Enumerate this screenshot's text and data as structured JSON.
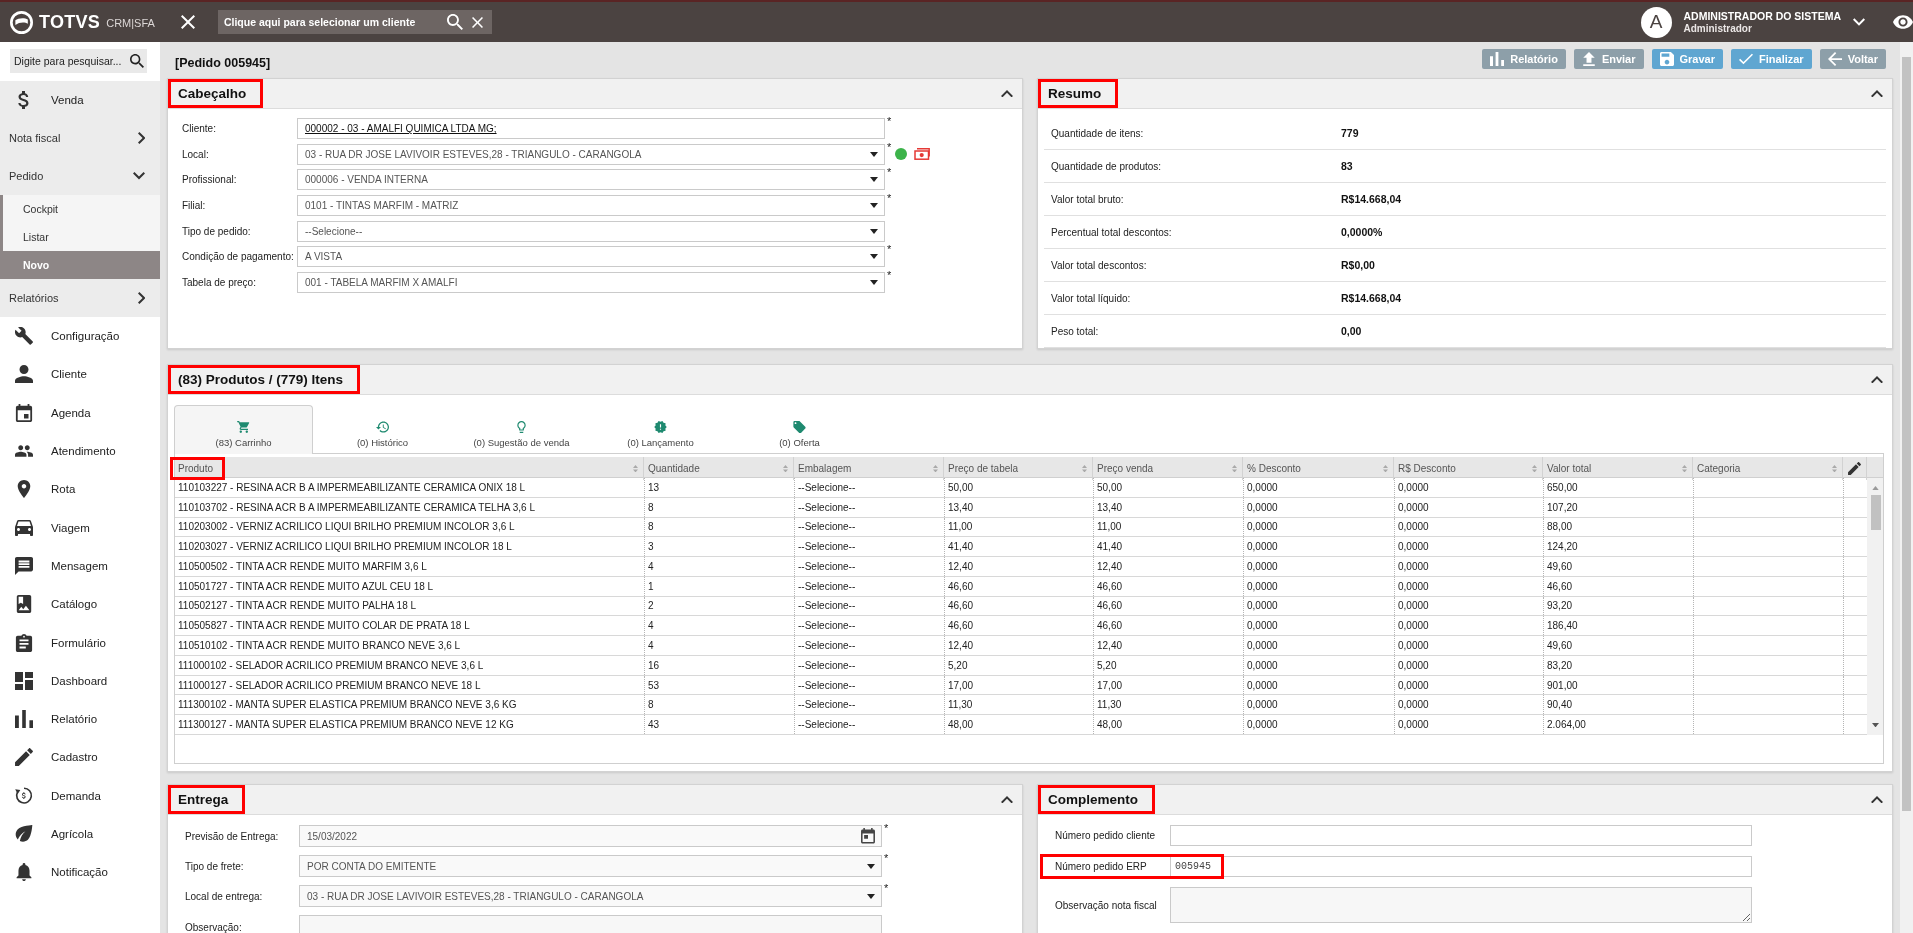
{
  "topbar": {
    "brand": "TOTVS",
    "product": "CRM|SFA",
    "client_search": {
      "placeholder": "Clique aqui para selecionar um cliente"
    },
    "user": {
      "initial": "A",
      "name": "ADMINISTRADOR DO SISTEMA",
      "role": "Administrador"
    }
  },
  "sidebar": {
    "search": {
      "placeholder": "Digite para pesquisar..."
    },
    "items": [
      {
        "label": "Venda",
        "selected": true,
        "children": [
          {
            "label": "Nota fiscal",
            "expanded": false
          },
          {
            "label": "Pedido",
            "expanded": true,
            "children": [
              {
                "label": "Cockpit",
                "selected": false
              },
              {
                "label": "Listar",
                "selected": false
              },
              {
                "label": "Novo",
                "selected": true
              }
            ]
          },
          {
            "label": "Relatórios",
            "expanded": false
          }
        ]
      },
      {
        "label": "Configuração",
        "selected": false
      },
      {
        "label": "Cliente",
        "selected": false
      },
      {
        "label": "Agenda",
        "selected": false
      },
      {
        "label": "Atendimento",
        "selected": false
      },
      {
        "label": "Rota",
        "selected": false
      },
      {
        "label": "Viagem",
        "selected": false
      },
      {
        "label": "Mensagem",
        "selected": false
      },
      {
        "label": "Catálogo",
        "selected": false
      },
      {
        "label": "Formulário",
        "selected": false
      },
      {
        "label": "Dashboard",
        "selected": false
      },
      {
        "label": "Relatório",
        "selected": false
      },
      {
        "label": "Cadastro",
        "selected": false
      },
      {
        "label": "Demanda",
        "selected": false
      },
      {
        "label": "Agrícola",
        "selected": false
      },
      {
        "label": "Notificação",
        "selected": false
      }
    ]
  },
  "page": {
    "title": "[Pedido 005945]",
    "actions": [
      {
        "label": "Relatório",
        "disabled": false
      },
      {
        "label": "Enviar",
        "disabled": false
      },
      {
        "label": "Gravar",
        "disabled": true
      },
      {
        "label": "Finalizar",
        "disabled": true
      },
      {
        "label": "Voltar",
        "disabled": false
      }
    ]
  },
  "cabecalho": {
    "title": "Cabeçalho",
    "highlighted": true,
    "expanded": true,
    "fields": [
      {
        "label": "Cliente:",
        "kind": "link",
        "value": "000002 - 03 - AMALFI QUIMICA LTDA MG;",
        "required_mark": "*"
      },
      {
        "label": "Local:",
        "kind": "select",
        "value": "03 - RUA DR JOSE LAVIVOIR ESTEVES,28 - TRIANGULO - CARANGOLA",
        "required_mark": "*",
        "color": "#3cb34a"
      },
      {
        "label": "Profissional:",
        "kind": "select",
        "value": "000006 - VENDA INTERNA",
        "required_mark": "*"
      },
      {
        "label": "Filial:",
        "kind": "select",
        "value": "0101 - TINTAS MARFIM - MATRIZ",
        "required_mark": "*"
      },
      {
        "label": "Tipo de pedido:",
        "kind": "select",
        "value": "--Selecione--"
      },
      {
        "label": "Condição de pagamento:",
        "kind": "select",
        "value": "A VISTA",
        "required_mark": "*"
      },
      {
        "label": "Tabela de preço:",
        "kind": "select",
        "value": "001 - TABELA MARFIM X AMALFI",
        "required_mark": "*"
      }
    ]
  },
  "resumo": {
    "title": "Resumo",
    "highlighted": true,
    "expanded": true,
    "rows": [
      {
        "label": "Quantidade de itens:",
        "value": "779"
      },
      {
        "label": "Quantidade de produtos:",
        "value": "83"
      },
      {
        "label": "Valor total bruto:",
        "value": "R$14.668,04"
      },
      {
        "label": "Percentual total descontos:",
        "value": "0,0000%"
      },
      {
        "label": "Valor total descontos:",
        "value": "R$0,00"
      },
      {
        "label": "Valor total líquido:",
        "value": "R$14.668,04"
      },
      {
        "label": "Peso total:",
        "value": "0,00"
      }
    ]
  },
  "produtos": {
    "title": "(83) Produtos / (779) Itens",
    "highlighted": true,
    "expanded": true,
    "tabs": [
      {
        "label": "(83) Carrinho",
        "selected": true
      },
      {
        "label": "(0) Histórico",
        "selected": false
      },
      {
        "label": "(0) Sugestão de venda",
        "selected": false
      },
      {
        "label": "(0) Lançamento",
        "selected": false
      },
      {
        "label": "(0) Oferta",
        "selected": false
      }
    ],
    "table": {
      "columns": [
        {
          "label": "Produto",
          "highlighted": true
        },
        {
          "label": "Quantidade",
          "highlighted": false
        },
        {
          "label": "Embalagem",
          "highlighted": false
        },
        {
          "label": "Preço de tabela",
          "highlighted": false
        },
        {
          "label": "Preço venda",
          "highlighted": false
        },
        {
          "label": "% Desconto",
          "highlighted": false
        },
        {
          "label": "R$ Desconto",
          "highlighted": false
        },
        {
          "label": "Valor total",
          "highlighted": false
        },
        {
          "label": "Categoria",
          "highlighted": false
        }
      ],
      "rows": [
        [
          "110103227 - RESINA ACR B A IMPERMEABILIZANTE CERAMICA ONIX 18 L",
          "13",
          "--Selecione--",
          "50,00",
          "50,00",
          "0,0000",
          "0,0000",
          "650,00"
        ],
        [
          "110103702 - RESINA ACR B A IMPERMEABILIZANTE CERAMICA TELHA 3,6 L",
          "8",
          "--Selecione--",
          "13,40",
          "13,40",
          "0,0000",
          "0,0000",
          "107,20"
        ],
        [
          "110203002 - VERNIZ ACRILICO LIQUI BRILHO PREMIUM INCOLOR 3,6 L",
          "8",
          "--Selecione--",
          "11,00",
          "11,00",
          "0,0000",
          "0,0000",
          "88,00"
        ],
        [
          "110203027 - VERNIZ ACRILICO LIQUI BRILHO PREMIUM INCOLOR 18 L",
          "3",
          "--Selecione--",
          "41,40",
          "41,40",
          "0,0000",
          "0,0000",
          "124,20"
        ],
        [
          "110500502 - TINTA ACR RENDE MUITO MARFIM 3,6 L",
          "4",
          "--Selecione--",
          "12,40",
          "12,40",
          "0,0000",
          "0,0000",
          "49,60"
        ],
        [
          "110501727 - TINTA ACR RENDE MUITO AZUL CEU 18 L",
          "1",
          "--Selecione--",
          "46,60",
          "46,60",
          "0,0000",
          "0,0000",
          "46,60"
        ],
        [
          "110502127 - TINTA ACR RENDE MUITO PALHA 18 L",
          "2",
          "--Selecione--",
          "46,60",
          "46,60",
          "0,0000",
          "0,0000",
          "93,20"
        ],
        [
          "110505827 - TINTA ACR RENDE MUITO COLAR DE PRATA 18 L",
          "4",
          "--Selecione--",
          "46,60",
          "46,60",
          "0,0000",
          "0,0000",
          "186,40"
        ],
        [
          "110510102 - TINTA ACR RENDE MUITO BRANCO NEVE 3,6 L",
          "4",
          "--Selecione--",
          "12,40",
          "12,40",
          "0,0000",
          "0,0000",
          "49,60"
        ],
        [
          "111000102 - SELADOR ACRILICO PREMIUM BRANCO NEVE 3,6 L",
          "16",
          "--Selecione--",
          "5,20",
          "5,20",
          "0,0000",
          "0,0000",
          "83,20"
        ],
        [
          "111000127 - SELADOR ACRILICO PREMIUM BRANCO NEVE 18 L",
          "53",
          "--Selecione--",
          "17,00",
          "17,00",
          "0,0000",
          "0,0000",
          "901,00"
        ],
        [
          "111300102 - MANTA SUPER ELASTICA PREMIUM BRANCO NEVE 3,6 KG",
          "8",
          "--Selecione--",
          "11,30",
          "11,30",
          "0,0000",
          "0,0000",
          "90,40"
        ],
        [
          "111300127 - MANTA SUPER ELASTICA PREMIUM BRANCO NEVE 12 KG",
          "43",
          "--Selecione--",
          "48,00",
          "48,00",
          "0,0000",
          "0,0000",
          "2.064,00"
        ]
      ]
    }
  },
  "entrega": {
    "title": "Entrega",
    "highlighted": true,
    "expanded": true,
    "fields": [
      {
        "label": "Previsão de Entrega:",
        "kind": "date",
        "value": "15/03/2022",
        "required_mark": "*"
      },
      {
        "label": "Tipo de frete:",
        "kind": "select",
        "value": "POR CONTA DO EMITENTE",
        "required_mark": "*"
      },
      {
        "label": "Local de entrega:",
        "kind": "select",
        "value": "03 - RUA DR JOSE LAVIVOIR ESTEVES,28 - TRIANGULO - CARANGOLA",
        "required_mark": "*"
      },
      {
        "label": "Observação:",
        "kind": "textarea"
      }
    ]
  },
  "complemento": {
    "title": "Complemento",
    "highlighted": true,
    "expanded": true,
    "fields": [
      {
        "label": "Número pedido cliente",
        "kind": "text",
        "highlighted": false
      },
      {
        "label": "Número pedido ERP",
        "kind": "text",
        "value": "005945",
        "highlighted": true
      },
      {
        "label": "Observação nota fiscal",
        "kind": "textarea",
        "highlighted": false
      }
    ]
  }
}
